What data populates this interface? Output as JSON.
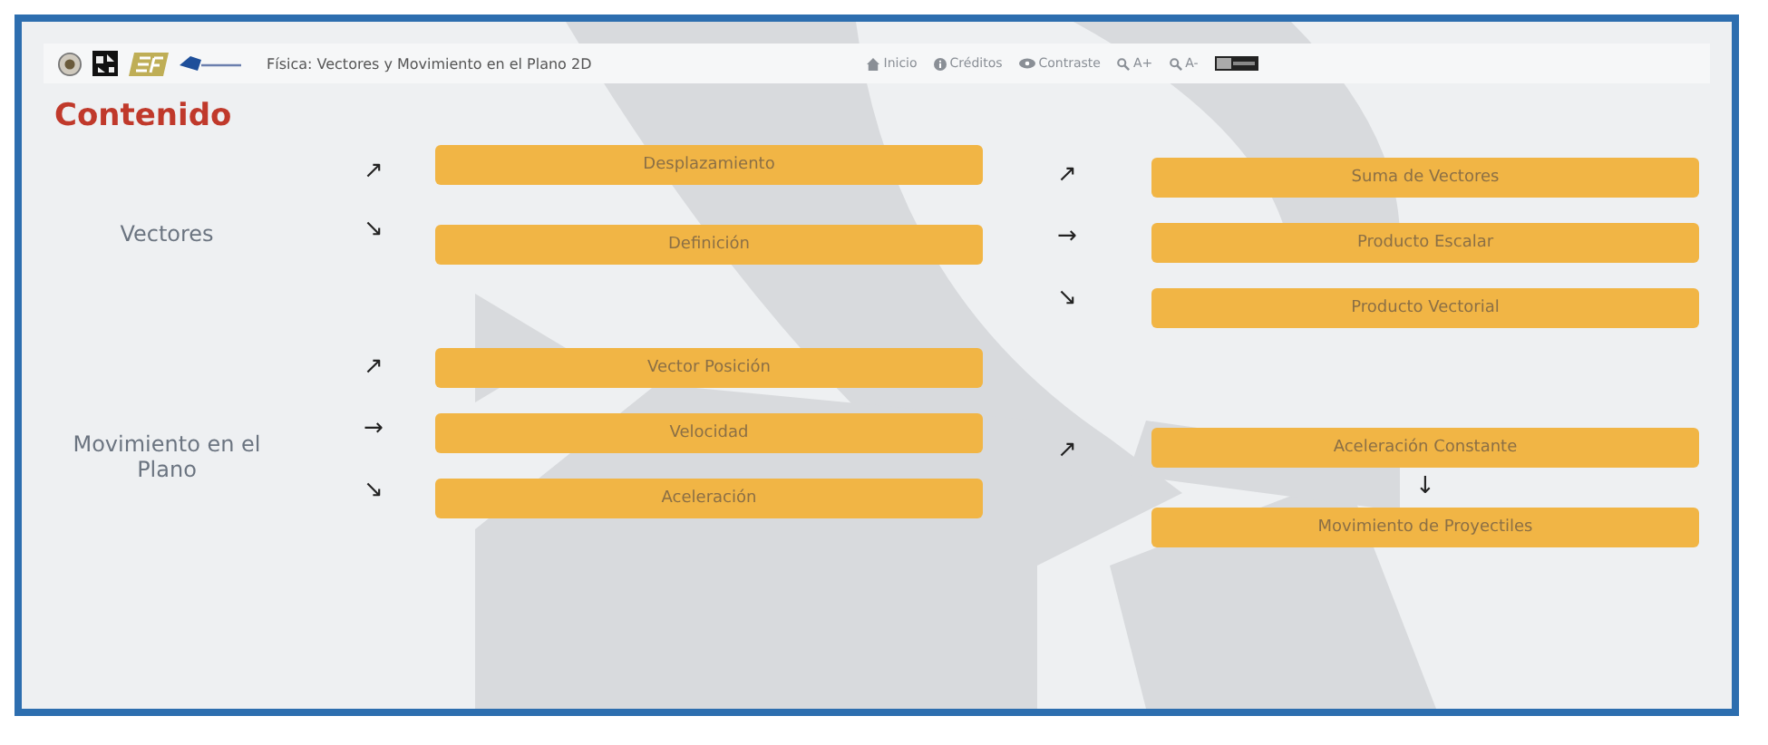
{
  "header": {
    "title": "Física: Vectores y Movimiento en el Plano 2D",
    "nav": [
      {
        "kind": "home",
        "label": "Inicio"
      },
      {
        "kind": "info",
        "label": "Créditos"
      },
      {
        "kind": "eye",
        "label": "Contraste"
      },
      {
        "kind": "zoom-in",
        "label": "A+"
      },
      {
        "kind": "zoom-out",
        "label": "A-"
      }
    ]
  },
  "heading": "Contenido",
  "sections": [
    {
      "label": "Vectores",
      "arrows": [
        "↗",
        "↘"
      ],
      "items": [
        "Desplazamiento",
        "Definición"
      ],
      "branch_arrows": [
        "↗",
        "→",
        "↘"
      ],
      "branches": [
        {
          "kind": "button",
          "label": "Suma de Vectores"
        },
        {
          "kind": "button",
          "label": "Producto Escalar"
        },
        {
          "kind": "button",
          "label": "Producto Vectorial"
        }
      ]
    },
    {
      "label": "Movimiento en el Plano",
      "arrows": [
        "↗",
        "→",
        "↘"
      ],
      "items": [
        "Vector Posición",
        "Velocidad",
        "Aceleración"
      ],
      "branch_arrows": [
        "↗"
      ],
      "branches": [
        {
          "kind": "button",
          "label": "Aceleración Constante"
        },
        {
          "kind": "arrow",
          "label": "↓"
        },
        {
          "kind": "button",
          "label": "Movimiento de Proyectiles"
        }
      ]
    }
  ]
}
